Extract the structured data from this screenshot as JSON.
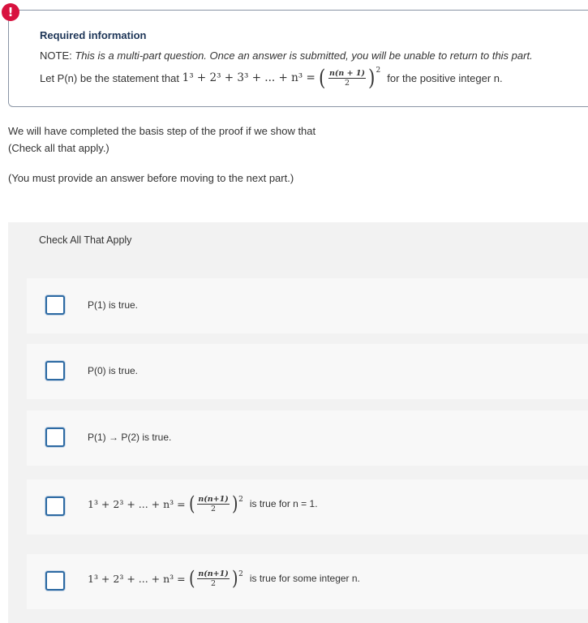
{
  "info": {
    "badge": "!",
    "title": "Required information",
    "note_prefix": "NOTE:",
    "note_text": "This is a multi-part question. Once an answer is submitted, you will be unable to return to this part.",
    "statement_prefix": "Let P(n) be the statement that",
    "statement_lhs": "1³ + 2³ + 3³ + ... + n³ =",
    "frac_num": "n(n + 1)",
    "frac_den": "2",
    "exponent": "2",
    "statement_suffix": "for the positive integer n."
  },
  "question": {
    "line1": "We will have completed the basis step of the proof if we show that",
    "line2": "(Check all that apply.)",
    "line3": "(You must provide an answer before moving to the next part.)"
  },
  "cata": {
    "header": "Check All That Apply",
    "options": [
      {
        "label": "P(1) is true.",
        "checked": false
      },
      {
        "label": "P(0) is true.",
        "checked": false
      },
      {
        "label": "P(1) → P(2) is true.",
        "checked": false
      },
      {
        "lhs": "1³ + 2³ + ... + n³ =",
        "frac_num": "n(n+1)",
        "frac_den": "2",
        "exponent": "2",
        "suffix": "is true for n = 1.",
        "checked": false
      },
      {
        "lhs": "1³ + 2³ + ... + n³ =",
        "frac_num": "n(n+1)",
        "frac_den": "2",
        "exponent": "2",
        "suffix": "is true for some integer n.",
        "checked": false
      }
    ]
  },
  "colors": {
    "badge": "#d8123f",
    "title": "#1d3557",
    "checkbox_border": "#2d6aa3",
    "panel_bg": "#f2f2f2"
  }
}
